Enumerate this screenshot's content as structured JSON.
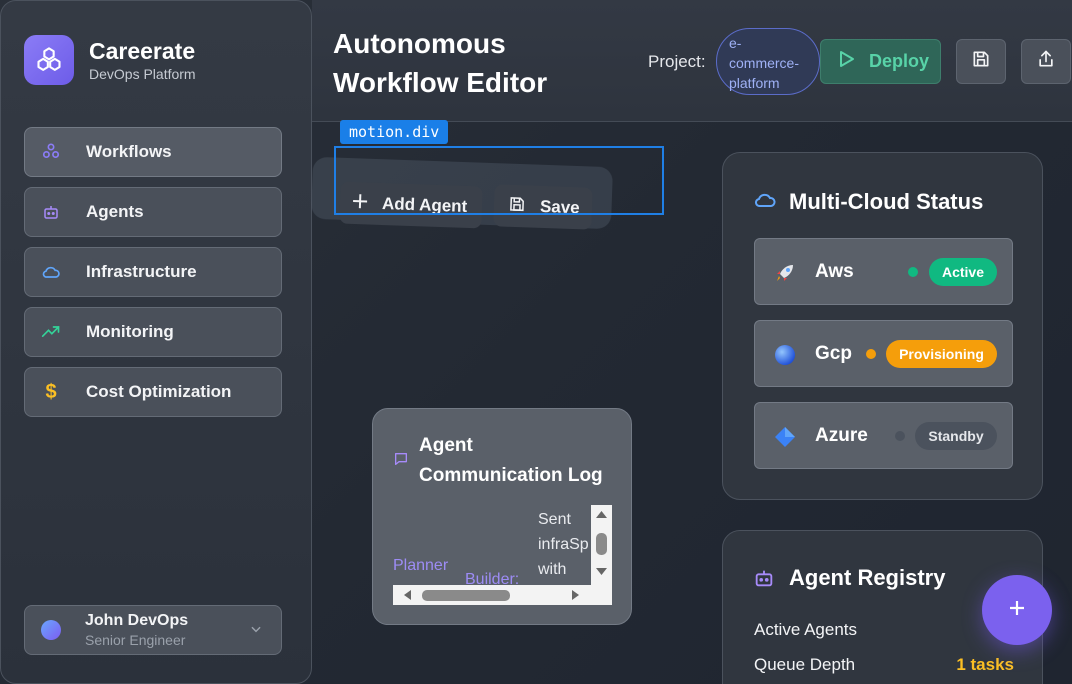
{
  "brand": {
    "name": "Careerate",
    "subtitle": "DevOps Platform",
    "logo_icon": "cubes-icon",
    "accent": "#7c6cf2"
  },
  "sidebar": {
    "items": [
      {
        "label": "Workflows",
        "icon": "workflow-icon",
        "active": true
      },
      {
        "label": "Agents",
        "icon": "bot-icon"
      },
      {
        "label": "Infrastructure",
        "icon": "cloud-icon"
      },
      {
        "label": "Monitoring",
        "icon": "trending-up-icon"
      },
      {
        "label": "Cost Optimization",
        "icon": "dollar-icon"
      }
    ],
    "user": {
      "name": "John DevOps",
      "role": "Senior Engineer"
    }
  },
  "header": {
    "title": "Autonomous Workflow Editor",
    "project_label": "Project:",
    "project_value": "e-commerce-platform",
    "deploy_label": "Deploy"
  },
  "canvas": {
    "debug_tag": "motion.div",
    "toolbar": {
      "add_agent_label": "Add Agent",
      "save_label": "Save"
    }
  },
  "agent_log": {
    "title": "Agent Communication Log",
    "entries": [
      {
        "from": "Planner",
        "to": "Builder:",
        "message": "Sent\ninfraSp\nwith"
      }
    ]
  },
  "multi_cloud": {
    "title": "Multi-Cloud Status",
    "providers": [
      {
        "name": "Aws",
        "icon": "rocket-icon",
        "status": "Active",
        "status_color": "#10b981",
        "dot_color": "#10b981"
      },
      {
        "name": "Gcp",
        "icon": "globe-icon",
        "status": "Provisioning",
        "status_color": "#f59e0b",
        "dot_color": "#f59e0b"
      },
      {
        "name": "Azure",
        "icon": "diamond-icon",
        "status": "Standby",
        "status_color": "#4b525d",
        "dot_color": "#4b525d"
      }
    ]
  },
  "registry": {
    "title": "Agent Registry",
    "rows": [
      {
        "label": "Active Agents",
        "value": ""
      },
      {
        "label": "Queue Depth",
        "value": "1 tasks"
      }
    ]
  },
  "fab": {
    "icon": "plus-icon"
  }
}
